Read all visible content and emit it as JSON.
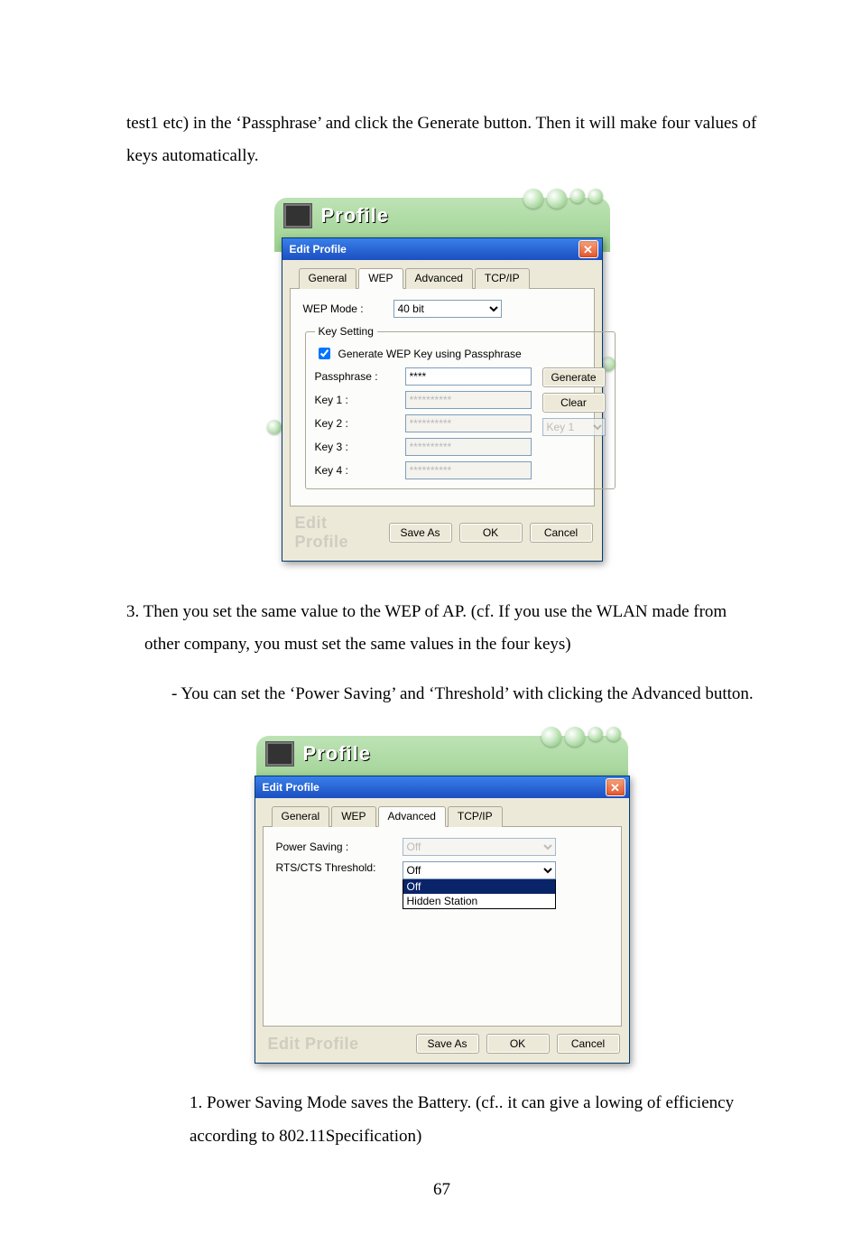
{
  "intro_text": "test1 etc) in the ‘Passphrase’ and click the Generate button. Then it will make four values of keys automatically.",
  "fig1": {
    "banner_title": "Profile",
    "modal_title": "Edit Profile",
    "tabs": {
      "t0": "General",
      "t1": "WEP",
      "t2": "Advanced",
      "t3": "TCP/IP"
    },
    "wep": {
      "mode_label": "WEP Mode :",
      "mode_value": "40 bit",
      "group_title": "Key Setting",
      "chk_label": "Generate WEP Key using Passphrase",
      "pass_label": "Passphrase :",
      "pass_value": "****",
      "k1_label": "Key 1 :",
      "k2_label": "Key 2 :",
      "k3_label": "Key 3 :",
      "k4_label": "Key 4 :",
      "kmask": "**********",
      "btn_generate": "Generate",
      "btn_clear": "Clear",
      "keysel": "Key 1"
    },
    "ghost": "Edit Profile",
    "btns": {
      "saveas": "Save As",
      "ok": "OK",
      "cancel": "Cancel"
    }
  },
  "step3": "3. Then you set the same value to the WEP of AP. (cf. If  you use the WLAN  made from other company, you must set the same values in the four keys)",
  "bullet": "-    You can set the ‘Power Saving’ and ‘Threshold’ with clicking the Advanced button.",
  "fig2": {
    "banner_title": "Profile",
    "modal_title": "Edit Profile",
    "tabs": {
      "t0": "General",
      "t1": "WEP",
      "t2": "Advanced",
      "t3": "TCP/IP"
    },
    "adv": {
      "ps_label": "Power Saving  :",
      "ps_value": "Off",
      "rts_label": "RTS/CTS Threshold:",
      "rts_value": "Off",
      "opt_off": "Off",
      "opt_hidden": "Hidden Station"
    },
    "ghost": "Edit Profile",
    "btns": {
      "saveas": "Save As",
      "ok": "OK",
      "cancel": "Cancel"
    }
  },
  "step1": "1.  Power Saving Mode saves the Battery. (cf.. it can  give a lowing of efficiency according to 802.11Specification)",
  "page_num": "67"
}
